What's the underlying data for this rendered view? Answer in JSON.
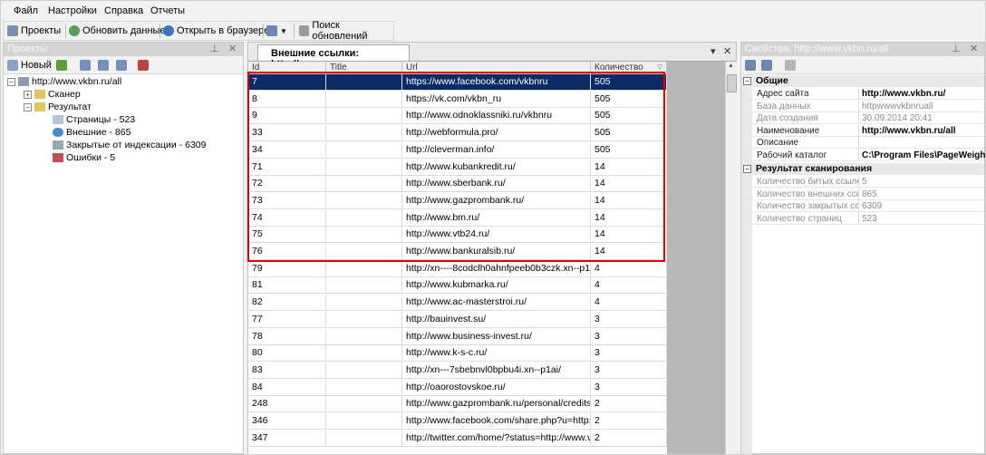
{
  "menu": [
    "Файл",
    "Настройки",
    "Справка",
    "Отчеты"
  ],
  "toolbar": {
    "projects": "Проекты",
    "refresh": "Обновить данные",
    "open_browser": "Открыть в браузере",
    "check_updates": "Поиск обновлений"
  },
  "left_panel": {
    "title": "Проекты",
    "new_button": "Новый",
    "tree": {
      "root": "http://www.vkbn.ru/all",
      "scanner": "Сканер",
      "result": "Результат",
      "pages": "Страницы - 523",
      "external": "Внешние - 865",
      "closed": "Закрытые от индексации - 6309",
      "errors": "Ошибки - 5"
    }
  },
  "center": {
    "tab_label": "Внешние ссылки: http://ww...",
    "columns": [
      "Id",
      "Title",
      "Url",
      "Количество"
    ],
    "rows": [
      {
        "id": "7",
        "title": "",
        "url": "https://www.facebook.com/vkbnru",
        "count": "505"
      },
      {
        "id": "8",
        "title": "",
        "url": "https://vk.com/vkbn_ru",
        "count": "505"
      },
      {
        "id": "9",
        "title": "",
        "url": "http://www.odnoklassniki.ru/vkbnru",
        "count": "505"
      },
      {
        "id": "33",
        "title": "",
        "url": "http://webformula.pro/",
        "count": "505"
      },
      {
        "id": "34",
        "title": "",
        "url": "http://cleverman.info/",
        "count": "505"
      },
      {
        "id": "71",
        "title": "",
        "url": "http://www.kubankredit.ru/",
        "count": "14"
      },
      {
        "id": "72",
        "title": "",
        "url": "http://www.sberbank.ru/",
        "count": "14"
      },
      {
        "id": "73",
        "title": "",
        "url": "http://www.gazprombank.ru/",
        "count": "14"
      },
      {
        "id": "74",
        "title": "",
        "url": "http://www.bm.ru/",
        "count": "14"
      },
      {
        "id": "75",
        "title": "",
        "url": "http://www.vtb24.ru/",
        "count": "14"
      },
      {
        "id": "76",
        "title": "",
        "url": "http://www.bankuralsib.ru/",
        "count": "14"
      },
      {
        "id": "79",
        "title": "",
        "url": "http://xn----8codclh0ahnfpeeb0b3czk.xn--p1ai/",
        "count": "4"
      },
      {
        "id": "81",
        "title": "",
        "url": "http://www.kubmarka.ru/",
        "count": "4"
      },
      {
        "id": "82",
        "title": "",
        "url": "http://www.ac-masterstroi.ru/",
        "count": "4"
      },
      {
        "id": "77",
        "title": "",
        "url": "http://bauinvest.su/",
        "count": "3"
      },
      {
        "id": "78",
        "title": "",
        "url": "http://www.business-invest.ru/",
        "count": "3"
      },
      {
        "id": "80",
        "title": "",
        "url": "http://www.k-s-c.ru/",
        "count": "3"
      },
      {
        "id": "83",
        "title": "",
        "url": "http://xn---7sbebnvl0bpbu4i.xn--p1ai/",
        "count": "3"
      },
      {
        "id": "84",
        "title": "",
        "url": "http://oaorostovskoe.ru/",
        "count": "3"
      },
      {
        "id": "248",
        "title": "",
        "url": "http://www.gazprombank.ru/personal/credits/7...",
        "count": "2"
      },
      {
        "id": "346",
        "title": "",
        "url": "http://www.facebook.com/share.php?u=http://...",
        "count": "2"
      },
      {
        "id": "347",
        "title": "",
        "url": "http://twitter.com/home/?status=http://www.vk...",
        "count": "2"
      }
    ]
  },
  "right_panel": {
    "title": "Свойства: http://www.vkbn.ru/all",
    "cat_general": "Общие",
    "props": [
      {
        "k": "Адрес сайта",
        "v": "http://www.vkbn.ru/",
        "dark": true
      },
      {
        "k": "База данных",
        "v": "httpwwwvkbnruall",
        "dark": false
      },
      {
        "k": "Дата создания",
        "v": "30.09.2014 20:41",
        "dark": false
      },
      {
        "k": "Наименование",
        "v": "http://www.vkbn.ru/all",
        "dark": true
      },
      {
        "k": "Описание",
        "v": "",
        "dark": true
      },
      {
        "k": "Рабочий каталог",
        "v": "C:\\Program Files\\PageWeigh",
        "dark": true
      }
    ],
    "cat_result": "Результат сканирования",
    "results": [
      {
        "k": "Количество битых ссылок",
        "v": "5"
      },
      {
        "k": "Количество внешних ссылок",
        "v": "865"
      },
      {
        "k": "Количество закрытых ссылок",
        "v": "6309"
      },
      {
        "k": "Количество страниц",
        "v": "523"
      }
    ]
  }
}
